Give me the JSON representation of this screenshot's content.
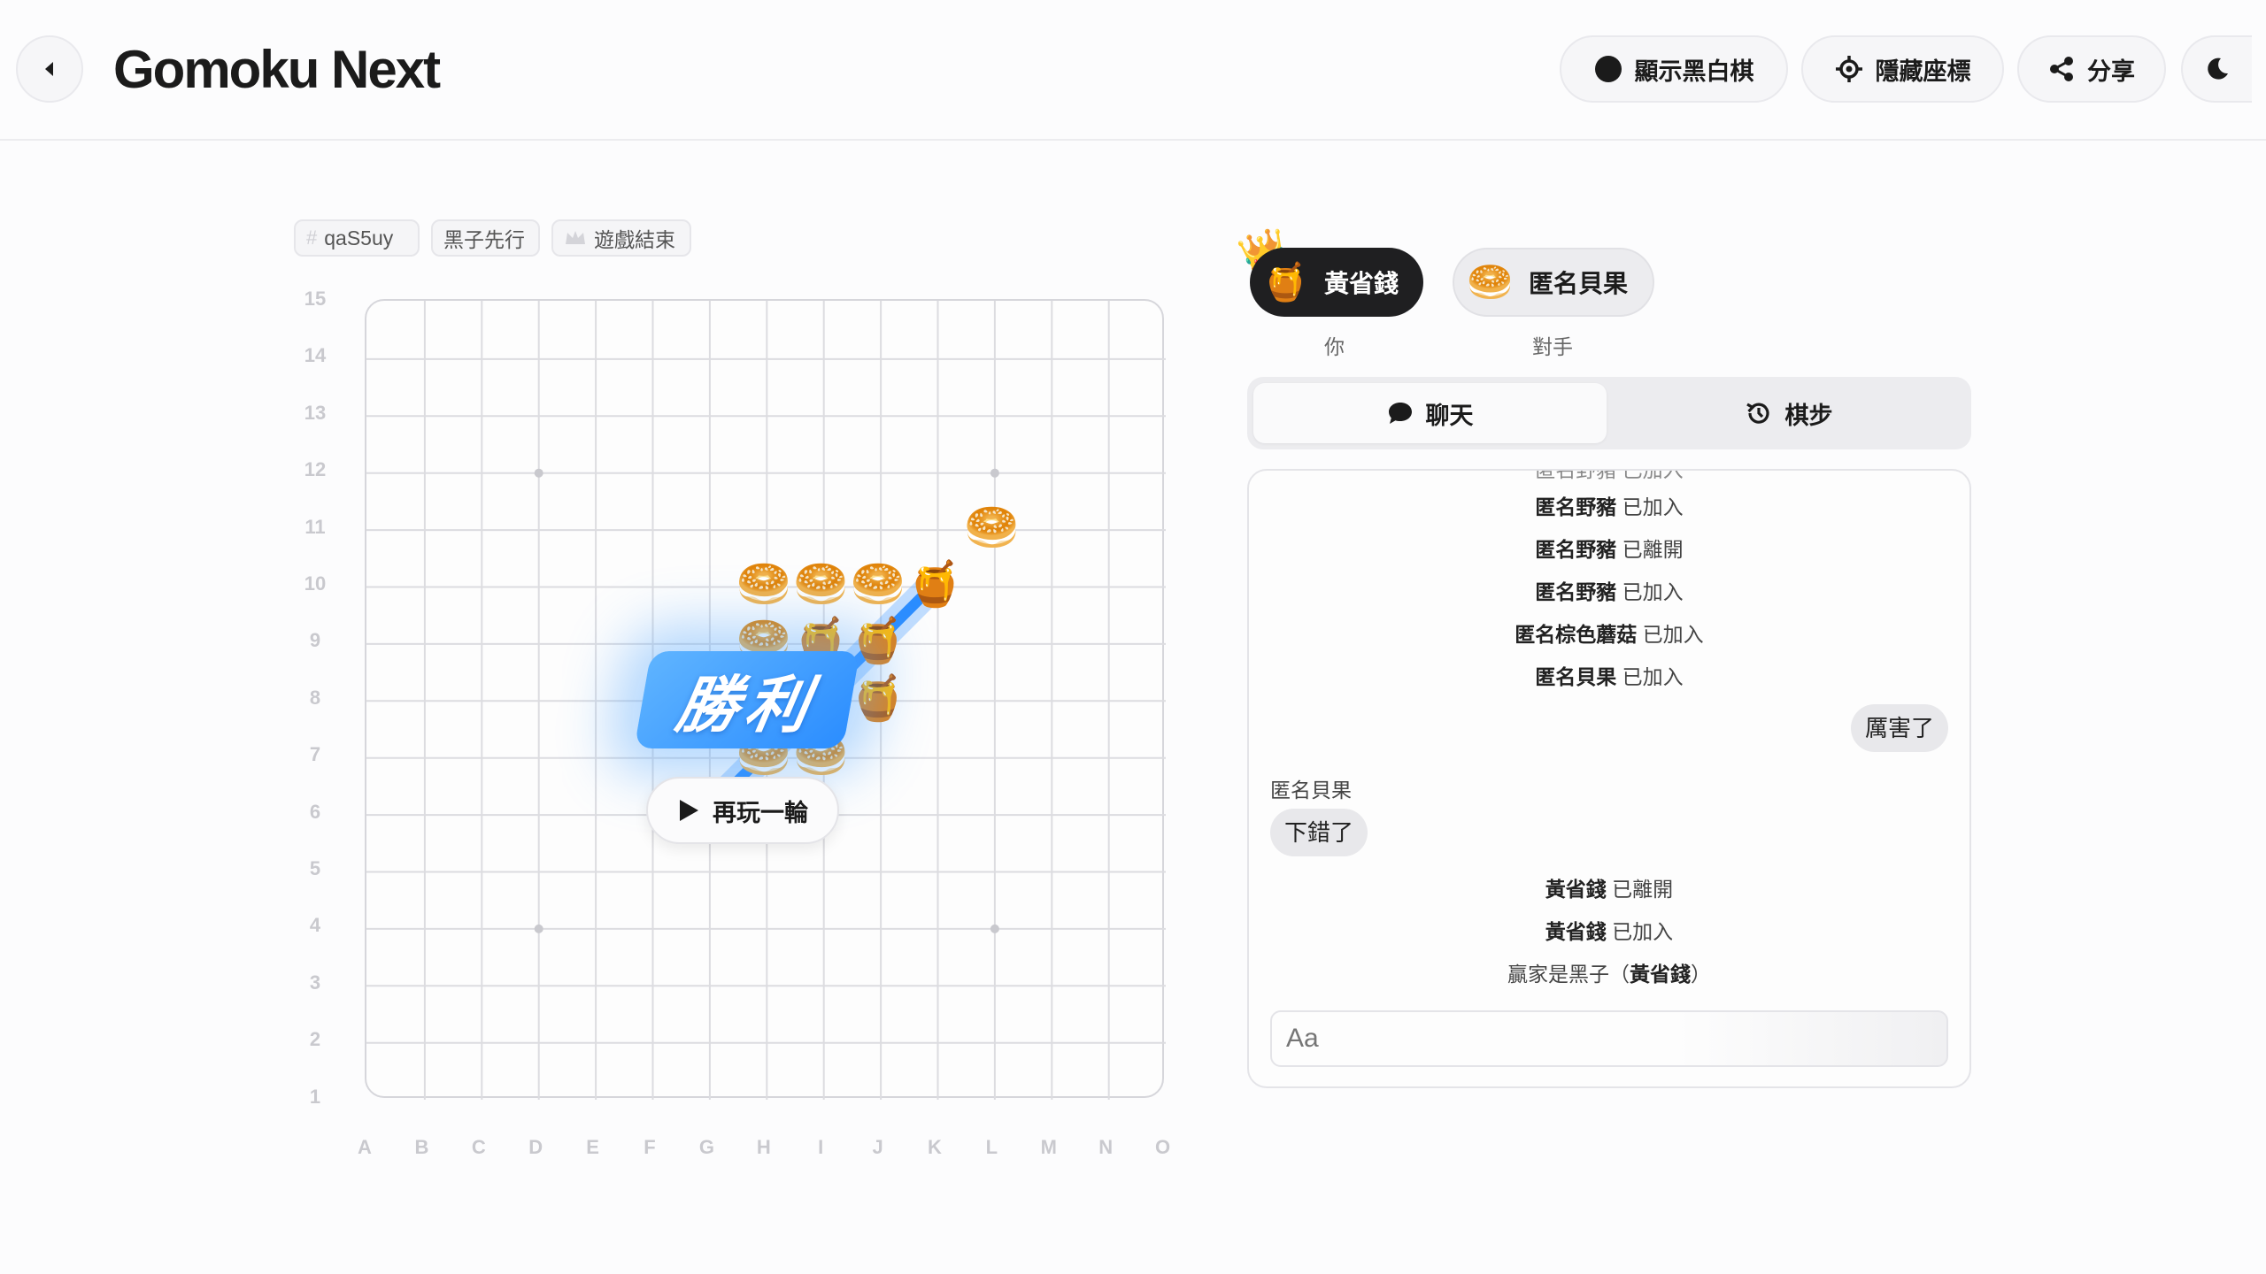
{
  "header": {
    "title": "Gomoku Next",
    "buttons": {
      "show_bw": "顯示黑白棋",
      "hide_coords": "隱藏座標",
      "share": "分享"
    }
  },
  "tags": {
    "room_id": "qaS5uy",
    "first_move": "黑子先行",
    "status": "遊戲結束"
  },
  "board": {
    "columns": [
      "A",
      "B",
      "C",
      "D",
      "E",
      "F",
      "G",
      "H",
      "I",
      "J",
      "K",
      "L",
      "M",
      "N",
      "O"
    ],
    "rows": [
      "15",
      "14",
      "13",
      "12",
      "11",
      "10",
      "9",
      "8",
      "7",
      "6",
      "5",
      "4",
      "3",
      "2",
      "1"
    ],
    "pieces": [
      {
        "coord": "L11",
        "type": "bagel"
      },
      {
        "coord": "H10",
        "type": "bagel"
      },
      {
        "coord": "I10",
        "type": "bagel"
      },
      {
        "coord": "J10",
        "type": "bagel"
      },
      {
        "coord": "K10",
        "type": "honey"
      },
      {
        "coord": "H9",
        "type": "bagel"
      },
      {
        "coord": "I9",
        "type": "honey"
      },
      {
        "coord": "J9",
        "type": "honey"
      },
      {
        "coord": "J8",
        "type": "honey"
      },
      {
        "coord": "H7",
        "type": "bagel"
      },
      {
        "coord": "I7",
        "type": "bagel"
      }
    ],
    "win_line": [
      "K10",
      "G6"
    ],
    "win_text": "勝利",
    "replay_label": "再玩一輪"
  },
  "players": {
    "me": {
      "name": "黃省錢",
      "role": "你",
      "avatar": "🍯",
      "winner_icon": "👑"
    },
    "opponent": {
      "name": "匿名貝果",
      "role": "對手",
      "avatar": "🥯"
    }
  },
  "tabs": {
    "chat": "聊天",
    "moves": "棋步",
    "active": "chat"
  },
  "chat": {
    "cut_text": "匿名野豬 已加入",
    "system": [
      {
        "name": "匿名野豬",
        "text": " 已加入"
      },
      {
        "name": "匿名野豬",
        "text": " 已離開"
      },
      {
        "name": "匿名野豬",
        "text": " 已加入"
      },
      {
        "name": "匿名棕色蘑菇",
        "text": " 已加入"
      },
      {
        "name": "匿名貝果",
        "text": " 已加入"
      }
    ],
    "my_message": "厲害了",
    "opponent_sender": "匿名貝果",
    "opponent_message": "下錯了",
    "system2": [
      {
        "name": "黃省錢",
        "text": " 已離開"
      },
      {
        "name": "黃省錢",
        "text": " 已加入"
      }
    ],
    "winner_prefix": "贏家是黑子（",
    "winner_name": "黃省錢",
    "winner_suffix": "）",
    "input_placeholder": "Aa"
  },
  "colors": {
    "accent_blue": "#2b8dff",
    "dark_pill": "#1f1f21"
  }
}
